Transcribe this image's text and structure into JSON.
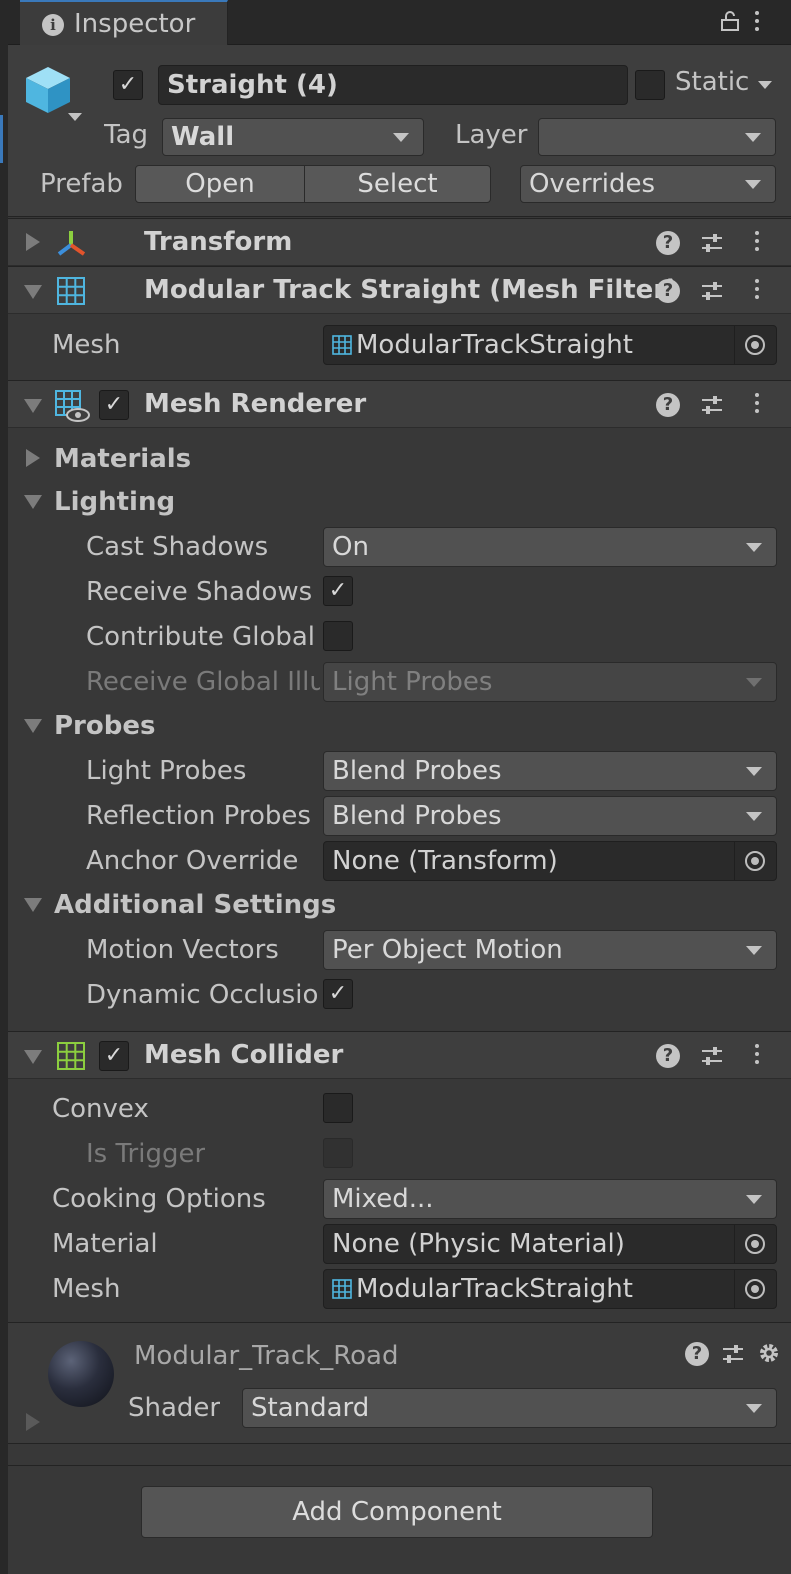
{
  "window": {
    "tab_label": "Inspector"
  },
  "object": {
    "name": "Straight (4)",
    "active": true,
    "static_label": "Static",
    "static_checked": false,
    "tag_label": "Tag",
    "tag_value": "Wall",
    "layer_label": "Layer",
    "layer_value": "",
    "prefab_label": "Prefab",
    "open_label": "Open",
    "select_label": "Select",
    "overrides_label": "Overrides"
  },
  "transform": {
    "title": "Transform"
  },
  "mesh_filter": {
    "title": "Modular Track Straight (Mesh Filter)",
    "mesh_label": "Mesh",
    "mesh_value": "ModularTrackStraight"
  },
  "mesh_renderer": {
    "title": "Mesh Renderer",
    "enabled": true,
    "materials_label": "Materials",
    "lighting_label": "Lighting",
    "cast_shadows_label": "Cast Shadows",
    "cast_shadows_value": "On",
    "receive_shadows_label": "Receive Shadows",
    "receive_shadows_checked": true,
    "contribute_gi_label": "Contribute Global I",
    "contribute_gi_checked": false,
    "receive_gi_label": "Receive Global Illu",
    "receive_gi_value": "Light Probes",
    "probes_label": "Probes",
    "light_probes_label": "Light Probes",
    "light_probes_value": "Blend Probes",
    "reflection_probes_label": "Reflection Probes",
    "reflection_probes_value": "Blend Probes",
    "anchor_override_label": "Anchor Override",
    "anchor_override_value": "None (Transform)",
    "additional_settings_label": "Additional Settings",
    "motion_vectors_label": "Motion Vectors",
    "motion_vectors_value": "Per Object Motion",
    "dynamic_occlusion_label": "Dynamic Occlusio",
    "dynamic_occlusion_checked": true
  },
  "mesh_collider": {
    "title": "Mesh Collider",
    "enabled": true,
    "convex_label": "Convex",
    "convex_checked": false,
    "is_trigger_label": "Is Trigger",
    "is_trigger_checked": false,
    "cooking_options_label": "Cooking Options",
    "cooking_options_value": "Mixed...",
    "material_label": "Material",
    "material_value": "None (Physic Material)",
    "mesh_label": "Mesh",
    "mesh_value": "ModularTrackStraight"
  },
  "material": {
    "name": "Modular_Track_Road",
    "shader_label": "Shader",
    "shader_value": "Standard"
  },
  "add_component_label": "Add Component",
  "colors": {
    "background": "#383838",
    "header": "#3e3e3e",
    "accent": "#3a79bb",
    "field": "#2a2a2a",
    "dropdown": "#515151"
  }
}
